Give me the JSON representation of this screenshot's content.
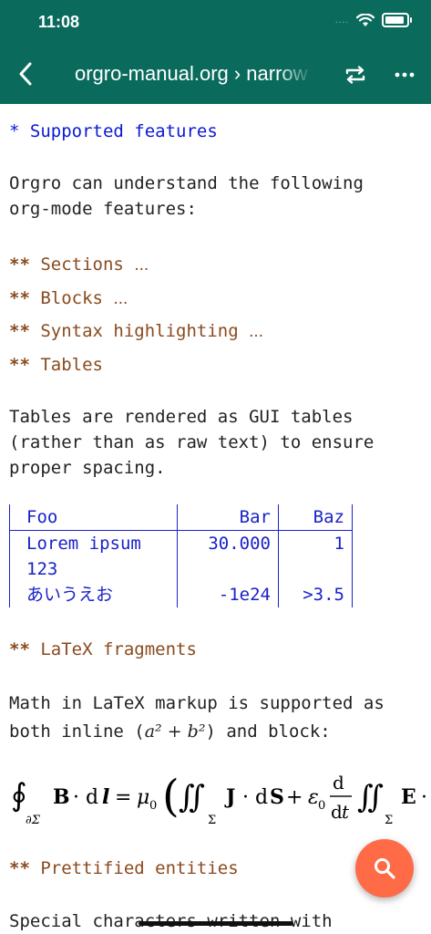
{
  "status_bar": {
    "time": "11:08",
    "signal": "....",
    "battery_level": 0.9
  },
  "nav": {
    "title": "orgro-manual.org › narrow",
    "back_icon": "chevron-left-icon",
    "swap_icon": "repeat-icon",
    "more_icon": "ellipsis-icon"
  },
  "doc": {
    "h1": {
      "stars": "*",
      "title": "Supported features"
    },
    "intro": [
      "Orgro can understand the following",
      "org-mode features:"
    ],
    "sections": [
      {
        "stars": "**",
        "title": "Sections",
        "ellipsis": "..."
      },
      {
        "stars": "**",
        "title": "Blocks",
        "ellipsis": "..."
      },
      {
        "stars": "**",
        "title": "Syntax highlighting",
        "ellipsis": "..."
      },
      {
        "stars": "**",
        "title": "Tables",
        "ellipsis": ""
      }
    ],
    "tables_para": [
      "Tables are rendered as GUI tables",
      "(rather than as raw text) to ensure",
      "proper spacing."
    ],
    "table": {
      "header": [
        "Foo",
        "Bar",
        "Baz"
      ],
      "rows": [
        [
          "Lorem ipsum",
          "30.000",
          "1"
        ],
        [
          "123",
          "",
          ""
        ],
        [
          "あいうえお",
          "-1e24",
          ">3.5"
        ]
      ]
    },
    "latex_heading": {
      "stars": "**",
      "title": "LaTeX fragments"
    },
    "latex_para": {
      "line1": "Math in LaTeX markup is supported as",
      "line2_pre": "both inline (",
      "line2_math": "a² + b²",
      "line2_post": ") and block:"
    },
    "formula": "∮∂Σ B · dl = μ0 (∬Σ J · dS + ε0 d/dt ∬Σ E ·",
    "entities_heading": {
      "stars": "**",
      "title": "Prettified entities"
    },
    "entities_para": "Special characters written with"
  },
  "fab": {
    "icon": "search-icon"
  },
  "colors": {
    "bar": "#0a6b5c",
    "h1": "#0a18d4",
    "h2": "#8a4a1e",
    "table": "#1a22c8",
    "fab": "#ff6b47"
  }
}
